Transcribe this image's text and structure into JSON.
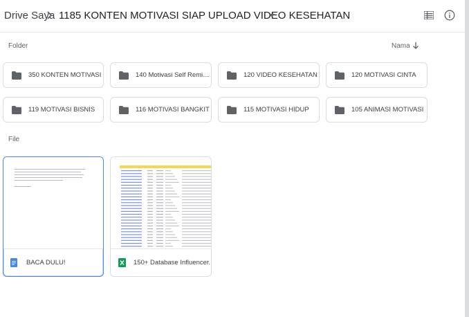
{
  "breadcrumb": {
    "root": "Drive Saya",
    "current": "1185 KONTEN MOTIVASI SIAP UPLOAD VIDEO KESEHATAN"
  },
  "toolbar": {
    "list_view_icon": "list-view-icon",
    "info_icon": "info-icon"
  },
  "sections": {
    "folders_label": "Folder",
    "files_label": "File"
  },
  "sort": {
    "label": "Nama",
    "direction": "down"
  },
  "folders": [
    {
      "name": "350 KONTEN MOTIVASI"
    },
    {
      "name": "140 Motivasi Self Remind..."
    },
    {
      "name": "120 VIDEO KESEHATAN"
    },
    {
      "name": "120 MOTIVASI CINTA"
    },
    {
      "name": "119 MOTIVASI BISNIS"
    },
    {
      "name": "116 MOTIVASI BANGKIT"
    },
    {
      "name": "115 MOTIVASI HIDUP"
    },
    {
      "name": "105 ANIMASI MOTIVASI"
    }
  ],
  "files": [
    {
      "name": "BACA DULU!",
      "type": "doc",
      "selected": true
    },
    {
      "name": "150+ Database Influencer....",
      "type": "sheet",
      "selected": false
    }
  ],
  "colors": {
    "doc_icon": "#4285f4",
    "sheet_icon": "#0f9d58",
    "folder_icon": "#5f6368",
    "selection": "#4a88e0"
  }
}
